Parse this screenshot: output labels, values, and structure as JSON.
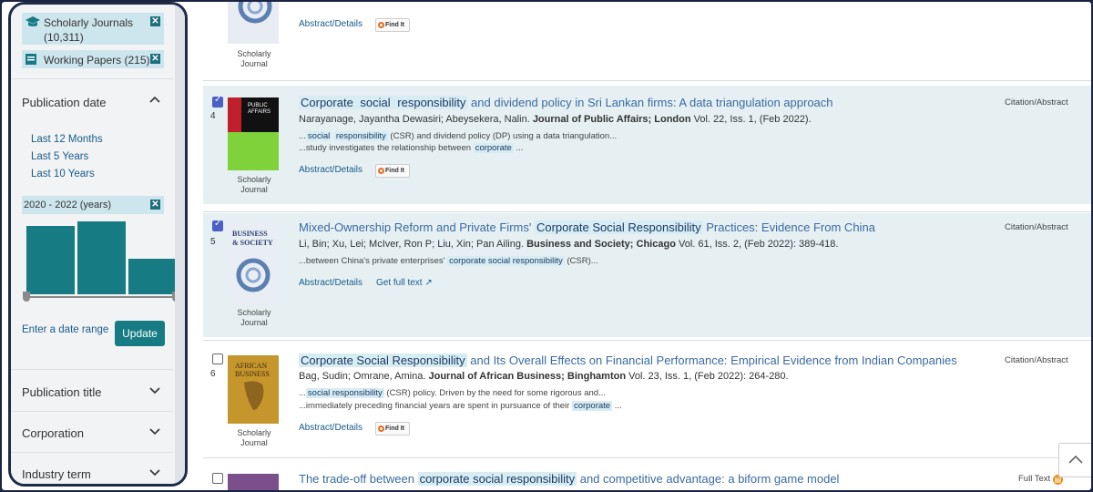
{
  "sidebar": {
    "active_filters": [
      {
        "label": "Scholarly Journals",
        "count": "(10,311)"
      },
      {
        "label": "Working Papers (215)"
      }
    ],
    "publication_date": {
      "title": "Publication date",
      "links": [
        "Last 12 Months",
        "Last 5 Years",
        "Last 10 Years"
      ],
      "range_chip": "2020 - 2022 (years)",
      "histogram_values": [
        100,
        106,
        52
      ],
      "enter_range": "Enter a date range",
      "update": "Update"
    },
    "facets": [
      "Publication title",
      "Corporation",
      "Industry term"
    ]
  },
  "results": [
    {
      "cover_label": "Scholarly\nJournal",
      "actions": {
        "abstract": "Abstract/Details",
        "findit": "Find It"
      }
    },
    {
      "number": "4",
      "checked": true,
      "title_parts": [
        {
          "text": "Corporate",
          "hl": true
        },
        {
          "text": " social ",
          "hl": true
        },
        {
          "text": "responsibility",
          "hl": true
        },
        {
          "text": " and dividend policy in Sri Lankan firms: A data triangulation approach",
          "hl": false
        }
      ],
      "authors": "Narayanage, Jayantha Dewasiri; Abeysekera, Nalin.",
      "journal": "Journal of Public Affairs; London",
      "citation": " Vol. 22, Iss. 1,  (Feb 2022).",
      "snippet1_a": "...",
      "snippet1_b": "social",
      "snippet1_c": "responsibility",
      "snippet1_d": " (CSR) and dividend policy (DP) using a data triangulation...",
      "snippet2_a": "...study investigates the relationship between ",
      "snippet2_b": "corporate",
      "snippet2_c": " ...",
      "cover_label": "Scholarly\nJournal",
      "actions": {
        "abstract": "Abstract/Details",
        "findit": "Find It"
      },
      "doctype": "Citation/Abstract"
    },
    {
      "number": "5",
      "checked": true,
      "title_pre": "Mixed-Ownership Reform and Private Firms' ",
      "title_hl": "Corporate  Social  Responsibility",
      "title_post": " Practices: Evidence From China",
      "authors": "Li, Bin; Xu, Lei; McIver, Ron P; Liu, Xin; Pan Ailing.",
      "journal": "Business and Society; Chicago",
      "citation": " Vol. 61, Iss. 2,  (Feb 2022): 389-418.",
      "snippet_a": "...between China's private enterprises' ",
      "snippet_b": "corporate  social  responsibility",
      "snippet_c": " (CSR)...",
      "cover_label": "Scholarly\nJournal",
      "actions": {
        "abstract": "Abstract/Details",
        "fulltext": "Get full text"
      },
      "doctype": "Citation/Abstract",
      "cover_text": [
        "BUSINESS",
        "& SOCIETY"
      ]
    },
    {
      "number": "6",
      "checked": false,
      "title_hl": "Corporate  Social  Responsibility",
      "title_post": " and Its Overall Effects on Financial Performance: Empirical Evidence from Indian Companies",
      "authors": "Bag, Sudin; Omrane, Amina.",
      "journal": "Journal of African Business; Binghamton",
      "citation": " Vol. 23, Iss. 1,  (Feb 2022): 264-280.",
      "snippet1_a": "...",
      "snippet1_b": "social  responsibility",
      "snippet1_c": " (CSR) policy. Driven by the need for some rigorous and...",
      "snippet2_a": "...immediately preceding financial years are spent in pursuance of their ",
      "snippet2_b": "corporate",
      "snippet2_c": " ...",
      "cover_label": "Scholarly\nJournal",
      "actions": {
        "abstract": "Abstract/Details",
        "findit": "Find It"
      },
      "doctype": "Citation/Abstract",
      "cover_text": [
        "AFRICAN",
        "BUSINESS"
      ]
    },
    {
      "checked": false,
      "title_pre": "The trade-off between ",
      "title_hl": "corporate  social  responsibility",
      "title_post": " and competitive advantage: a biform game model",
      "doctype": "Full Text"
    }
  ],
  "colors": {
    "accent": "#177b83",
    "link": "#3a6aa3",
    "highlight": "#d7ecf3",
    "checkbox": "#4b5fc8"
  }
}
